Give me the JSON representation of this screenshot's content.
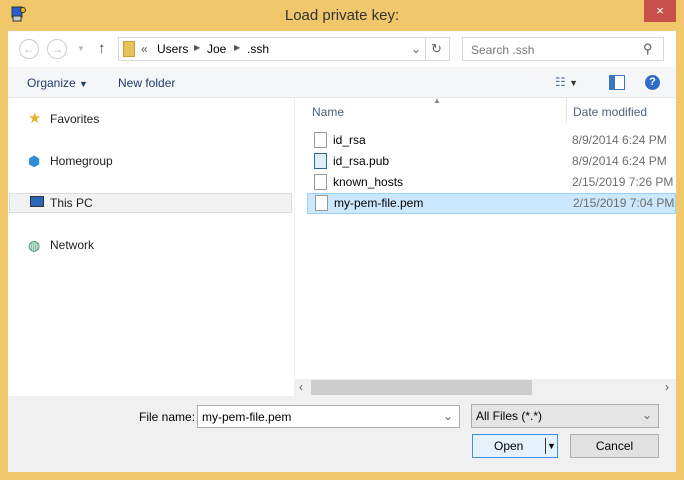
{
  "window": {
    "title": "Load private key:",
    "close": "×"
  },
  "nav": {
    "back": "←",
    "forward": "→",
    "up": "↑",
    "breadcrumb": [
      "«",
      "Users",
      "Joe",
      ".ssh"
    ],
    "search_placeholder": "Search .ssh"
  },
  "toolbar": {
    "organize": "Organize",
    "new_folder": "New folder"
  },
  "sidebar": {
    "items": [
      {
        "label": "Favorites"
      },
      {
        "label": "Homegroup"
      },
      {
        "label": "This PC"
      },
      {
        "label": "Network"
      }
    ]
  },
  "columns": {
    "name": "Name",
    "date": "Date modified"
  },
  "files": [
    {
      "name": "id_rsa",
      "date": "8/9/2014 6:24 PM"
    },
    {
      "name": "id_rsa.pub",
      "date": "8/9/2014 6:24 PM"
    },
    {
      "name": "known_hosts",
      "date": "2/15/2019 7:26 PM"
    },
    {
      "name": "my-pem-file.pem",
      "date": "2/15/2019 7:04 PM"
    }
  ],
  "bottom": {
    "file_name_label": "File name:",
    "file_name_value": "my-pem-file.pem",
    "file_type": "All Files (*.*)",
    "open": "Open",
    "cancel": "Cancel"
  }
}
